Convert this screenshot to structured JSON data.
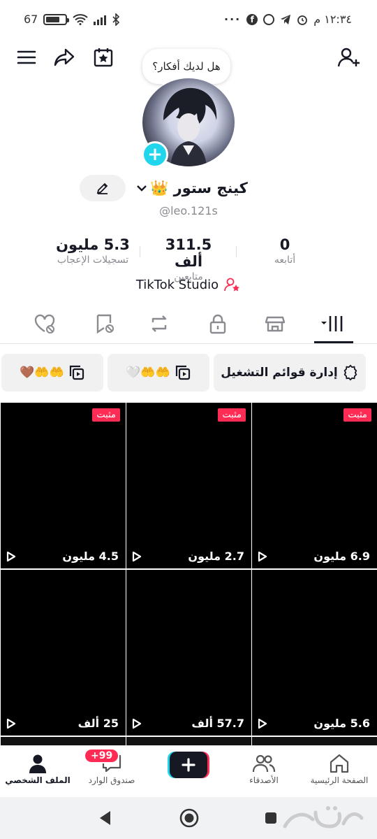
{
  "status_bar": {
    "time": "١٢:٣٤ م",
    "battery": "67"
  },
  "top_bar": {
    "ideas_bubble": "هل لديك أفكار؟"
  },
  "profile": {
    "name": "كينج ستور 👑",
    "handle": "@leo.121s",
    "stats": [
      {
        "value": "5.3 مليون",
        "label": "تسجيلات الإعجاب"
      },
      {
        "value": "311.5 ألف",
        "label": "متابعين"
      },
      {
        "value": "0",
        "label": "أتابعه"
      }
    ],
    "studio_label": "TikTok Studio"
  },
  "playlists": [
    {
      "label": "إدارة قوائم التشغيل"
    },
    {
      "label": "🤲🤲🤍"
    },
    {
      "label": "🤲🤲🤎"
    }
  ],
  "videos": [
    {
      "views": "6.9 مليون",
      "pinned": "مثبت"
    },
    {
      "views": "2.7 مليون",
      "pinned": "مثبت"
    },
    {
      "views": "4.5 مليون",
      "pinned": "مثبت"
    },
    {
      "views": "5.6 مليون",
      "pinned": ""
    },
    {
      "views": "57.7 ألف",
      "pinned": ""
    },
    {
      "views": "25 ألف",
      "pinned": ""
    }
  ],
  "bottom_nav": {
    "home": "الصفحة الرئيسية",
    "friends": "الأصدقاء",
    "inbox": "صندوق الوارد",
    "inbox_badge": "+99",
    "profile": "الملف الشخصي"
  },
  "colors": {
    "accent": "#fe2c55",
    "cyan": "#20d5ec",
    "text": "#161823",
    "muted": "#8a8b91"
  }
}
